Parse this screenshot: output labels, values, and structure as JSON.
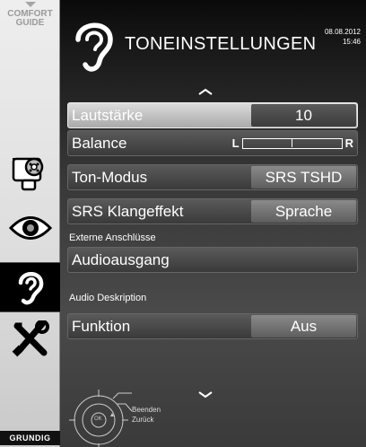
{
  "sidebar": {
    "comfort_guide": "COMFORT\nGUIDE",
    "comfort_line1": "COMFORT",
    "comfort_line2": "GUIDE",
    "items": [
      {
        "name": "source-icon"
      },
      {
        "name": "picture-eye-icon"
      },
      {
        "name": "sound-ear-icon",
        "active": true
      },
      {
        "name": "tools-icon"
      }
    ],
    "brand": "GRUNDIG"
  },
  "header": {
    "title": "TONEINSTELLUNGEN",
    "date": "08.08.2012",
    "time": "15:46"
  },
  "menu": {
    "lautstaerke": {
      "label": "Lautstärke",
      "value": "10"
    },
    "balance": {
      "label": "Balance",
      "left": "L",
      "right": "R",
      "position": 0.5
    },
    "ton_modus": {
      "label": "Ton-Modus",
      "value": "SRS TSHD"
    },
    "srs": {
      "label": "SRS Klangeffekt",
      "value": "Sprache"
    },
    "externe_header": "Externe Anschlüsse",
    "audioausgang": {
      "label": "Audioausgang"
    },
    "audio_desc_header": "Audio Deskription",
    "funktion": {
      "label": "Funktion",
      "value": "Aus"
    }
  },
  "remote": {
    "ok": "OK",
    "beenden": "Beenden",
    "zurueck": "Zurück"
  },
  "colors": {
    "selected_row": "#c4c4c4",
    "row": "#474747",
    "value_box": "#777777"
  }
}
